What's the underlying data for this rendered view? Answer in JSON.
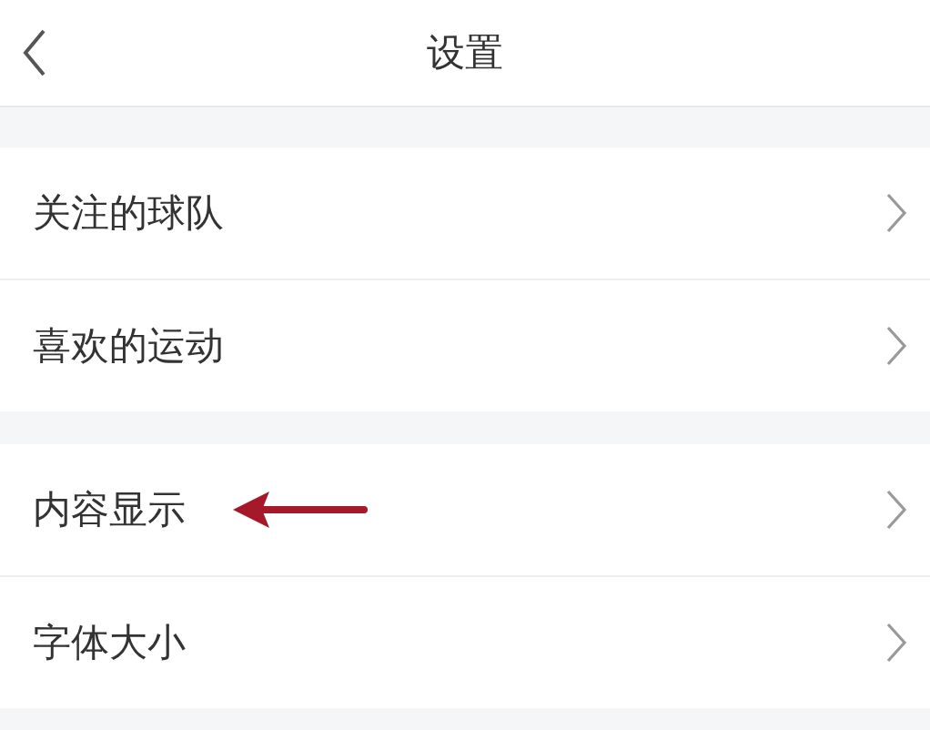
{
  "header": {
    "title": "设置"
  },
  "sections": [
    {
      "items": [
        {
          "label": "关注的球队",
          "marked": false
        },
        {
          "label": "喜欢的运动",
          "marked": false
        }
      ]
    },
    {
      "items": [
        {
          "label": "内容显示",
          "marked": true
        },
        {
          "label": "字体大小",
          "marked": false
        }
      ]
    }
  ]
}
